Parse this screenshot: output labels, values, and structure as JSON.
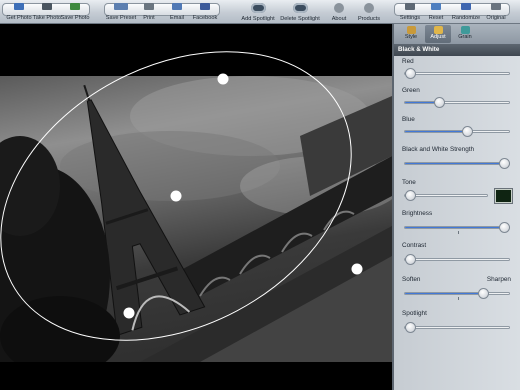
{
  "toolbar": {
    "left_group": [
      {
        "label": "Get Photo",
        "icon": "get-photo-icon"
      },
      {
        "label": "Take Photo",
        "icon": "camera-icon"
      },
      {
        "label": "Save Photo",
        "icon": "save-photo-icon"
      }
    ],
    "share_group": [
      {
        "label": "Save Preset",
        "icon": "save-preset-icon"
      },
      {
        "label": "Print",
        "icon": "print-icon"
      },
      {
        "label": "Email",
        "icon": "email-icon"
      },
      {
        "label": "Facebook",
        "icon": "facebook-icon"
      }
    ],
    "spot_group": [
      {
        "label": "Add Spotlight",
        "icon": "add-spotlight-icon"
      },
      {
        "label": "Delete Spotlight",
        "icon": "delete-spotlight-icon"
      }
    ],
    "about_label": "About",
    "products_label": "Products",
    "right_group": [
      {
        "label": "Settings",
        "icon": "settings-icon"
      },
      {
        "label": "Reset",
        "icon": "reset-icon"
      },
      {
        "label": "Randomize",
        "icon": "randomize-icon"
      },
      {
        "label": "Original",
        "icon": "original-icon"
      }
    ]
  },
  "tabs": [
    {
      "label": "Style",
      "icon": "style-icon",
      "active": false
    },
    {
      "label": "Adjust",
      "icon": "adjust-icon",
      "active": true
    },
    {
      "label": "Grain",
      "icon": "grain-icon",
      "active": false
    }
  ],
  "section_title": "Black & White",
  "controls": {
    "red": {
      "label": "Red",
      "value": 0.02
    },
    "green": {
      "label": "Green",
      "value": 0.33
    },
    "blue": {
      "label": "Blue",
      "value": 0.6
    },
    "strength": {
      "label": "Black and White Strength",
      "value": 1.0
    },
    "tone": {
      "label": "Tone",
      "value": 0.0,
      "swatch_color": "#0f2412"
    },
    "brightness": {
      "label": "Brightness",
      "value": 1.0
    },
    "contrast": {
      "label": "Contrast",
      "value": 0.0
    },
    "soften": {
      "label": "Soften",
      "label_right": "Sharpen",
      "value": 0.75
    },
    "spotlight": {
      "label": "Spotlight",
      "value": 0.0
    }
  },
  "colors": {
    "accent": "#2a62c8",
    "panel_header": "#4a535c"
  }
}
